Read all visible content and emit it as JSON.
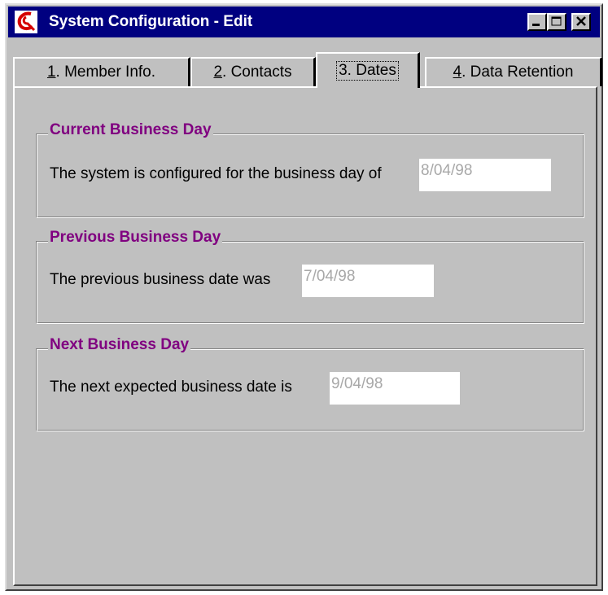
{
  "window": {
    "title": "System Configuration - Edit"
  },
  "tabs": [
    {
      "label": "1. Member Info.",
      "mnemonic": "1",
      "rest": ". Member Info.",
      "active": false
    },
    {
      "label": "2. Contacts",
      "mnemonic": "2",
      "rest": ". Contacts",
      "active": false
    },
    {
      "label": "3. Dates",
      "mnemonic": "",
      "rest": "3. Dates",
      "active": true
    },
    {
      "label": "4. Data Retention",
      "mnemonic": "4",
      "rest": ". Data Retention",
      "active": false
    }
  ],
  "groups": {
    "current": {
      "title": "Current Business Day",
      "label": "The system is configured for the business day of",
      "value": "8/04/98"
    },
    "previous": {
      "title": "Previous Business Day",
      "label": "The previous business date was",
      "value": "7/04/98"
    },
    "next": {
      "title": "Next Business Day",
      "label": "The next expected business date is",
      "value": "9/04/98"
    }
  },
  "colors": {
    "titlebar": "#000080",
    "group_title": "#800080",
    "face": "#c0c0c0",
    "disabled_text": "#a8a8a8"
  },
  "icons": {
    "app": "app-logo-icon",
    "minimize": "minimize-icon",
    "maximize": "maximize-icon",
    "close": "close-icon"
  }
}
